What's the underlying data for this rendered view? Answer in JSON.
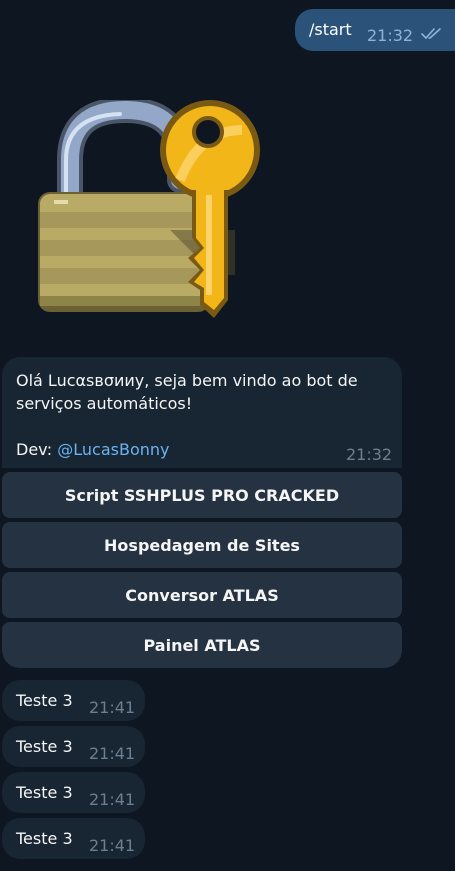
{
  "outgoing": {
    "text": "/start",
    "time": "21:32",
    "status_icon": "double-check-icon"
  },
  "sticker": {
    "icon": "lock-and-key-sticker"
  },
  "bot_message": {
    "line1": "Olá Lucαѕвσииу, seja bem vindo ao bot de",
    "line2": "serviços automáticos!",
    "dev_label": "Dev:",
    "dev_mention": "@LucasBonny",
    "time": "21:32"
  },
  "keyboard": [
    "Script SSHPLUS PRO CRACKED",
    "Hospedagem de Sites",
    "Conversor ATLAS",
    "Painel ATLAS"
  ],
  "messages": [
    {
      "text": "Teste 3",
      "time": "21:41"
    },
    {
      "text": "Teste 3",
      "time": "21:41"
    },
    {
      "text": "Teste 3",
      "time": "21:41"
    },
    {
      "text": "Teste 3",
      "time": "21:41"
    }
  ],
  "colors": {
    "background": "#0e1621",
    "outgoing_bubble": "#2b5278",
    "incoming_bubble": "#182533",
    "keyboard_button": "#243241",
    "link": "#6ab3f3",
    "check": "#8fb4d9"
  }
}
